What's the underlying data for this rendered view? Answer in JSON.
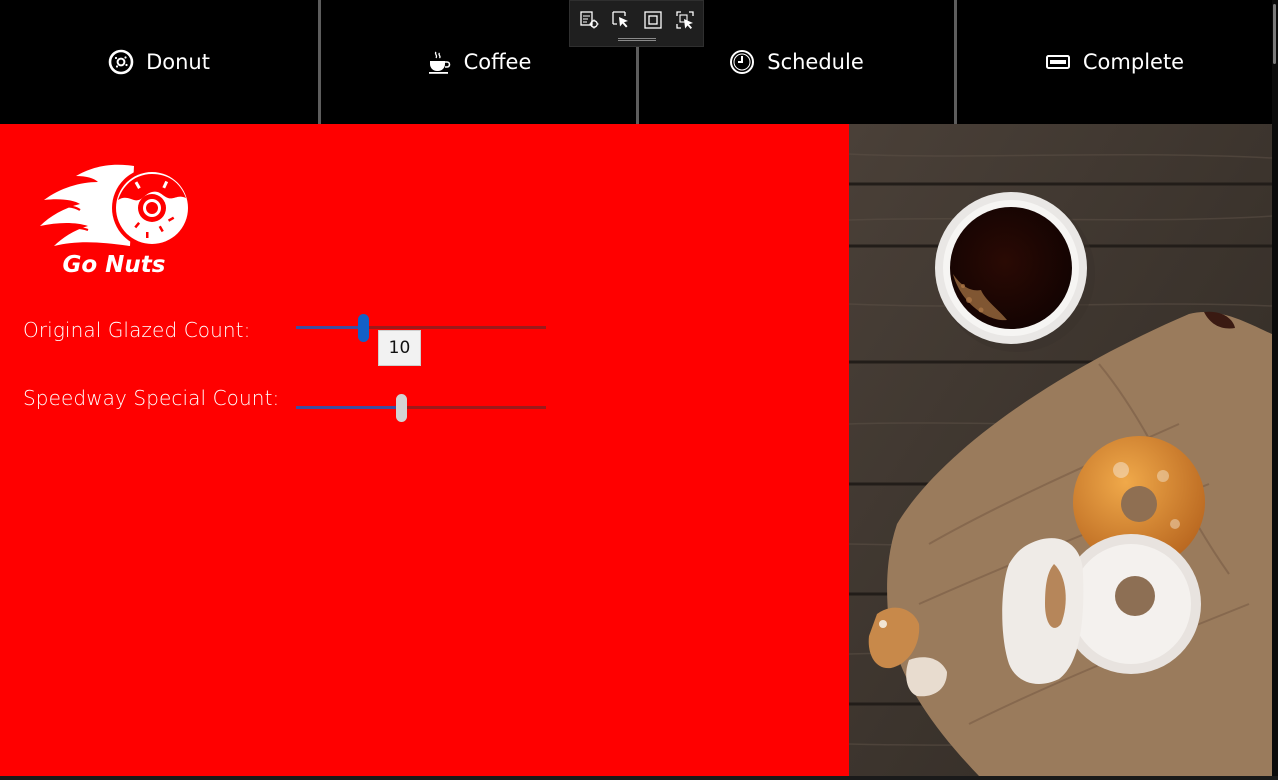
{
  "nav": {
    "items": [
      {
        "label": "Donut",
        "icon": "donut-icon"
      },
      {
        "label": "Coffee",
        "icon": "coffee-cup-icon"
      },
      {
        "label": "Schedule",
        "icon": "clock-icon"
      },
      {
        "label": "Complete",
        "icon": "ticket-icon"
      }
    ]
  },
  "debug_toolbar": {
    "icons": [
      "live-visual-tree-icon",
      "select-element-icon",
      "display-layout-adorners-icon",
      "track-focus-icon"
    ]
  },
  "brand": {
    "logo_text": "Go Nuts",
    "primary_color": "#ff0000"
  },
  "form": {
    "original_glazed": {
      "label": "Original Glazed Count:",
      "value": 10,
      "value_text": "10",
      "fraction": 0.26
    },
    "speedway_special": {
      "label": "Speedway Special Count:",
      "fraction": 0.42
    }
  },
  "photo": {
    "description_icon": "coffee-and-donuts-photo"
  }
}
